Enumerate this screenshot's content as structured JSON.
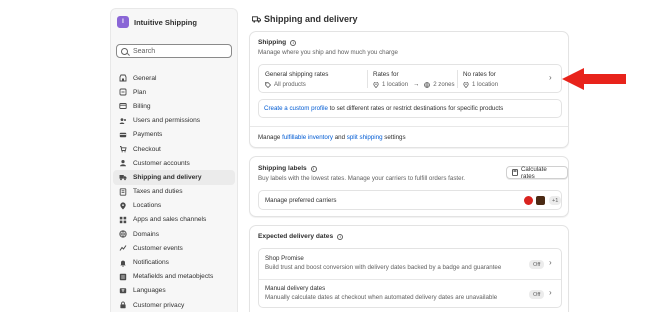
{
  "store": {
    "avatar_letter": "I",
    "name": "Intuitive Shipping"
  },
  "search": {
    "placeholder": "Search"
  },
  "sidebar": {
    "items": [
      {
        "label": "General",
        "icon": "store-icon"
      },
      {
        "label": "Plan",
        "icon": "plan-icon"
      },
      {
        "label": "Billing",
        "icon": "billing-icon"
      },
      {
        "label": "Users and permissions",
        "icon": "users-icon"
      },
      {
        "label": "Payments",
        "icon": "payments-icon"
      },
      {
        "label": "Checkout",
        "icon": "checkout-icon"
      },
      {
        "label": "Customer accounts",
        "icon": "customer-icon"
      },
      {
        "label": "Shipping and delivery",
        "icon": "truck-icon",
        "active": true
      },
      {
        "label": "Taxes and duties",
        "icon": "taxes-icon"
      },
      {
        "label": "Locations",
        "icon": "location-icon"
      },
      {
        "label": "Apps and sales channels",
        "icon": "apps-icon"
      },
      {
        "label": "Domains",
        "icon": "globe-icon"
      },
      {
        "label": "Customer events",
        "icon": "events-icon"
      },
      {
        "label": "Notifications",
        "icon": "bell-icon"
      },
      {
        "label": "Metafields and metaobjects",
        "icon": "metafields-icon"
      },
      {
        "label": "Languages",
        "icon": "languages-icon"
      },
      {
        "label": "Customer privacy",
        "icon": "lock-icon"
      },
      {
        "label": "Policies",
        "icon": "policies-icon"
      }
    ]
  },
  "page": {
    "title": "Shipping and delivery",
    "icon": "truck-icon"
  },
  "shipping": {
    "title": "Shipping",
    "subtitle": "Manage where you ship and how much you charge",
    "general_rates": {
      "label": "General shipping rates",
      "products": "All products",
      "rates_for": "Rates for",
      "location": "1 location",
      "zones": "2 zones",
      "no_rates_for": "No rates for",
      "no_rates_location": "1 location"
    },
    "custom_profile": {
      "link": "Create a custom profile",
      "rest": " to set different rates or restrict destinations for specific products"
    },
    "footer": {
      "prefix": "Manage ",
      "link1": "fulfillable inventory",
      "mid": " and ",
      "link2": "split shipping",
      "suffix": " settings"
    }
  },
  "labels": {
    "title": "Shipping labels",
    "subtitle": "Buy labels with the lowest rates. Manage your carriers to fulfill orders faster.",
    "calculate_button": "Calculate rates",
    "manage_carriers": "Manage preferred carriers",
    "more_count": "+1"
  },
  "delivery": {
    "title": "Expected delivery dates",
    "items": [
      {
        "title": "Shop Promise",
        "desc": "Build trust and boost conversion with delivery dates backed by a badge and guarantee",
        "status": "Off"
      },
      {
        "title": "Manual delivery dates",
        "desc": "Manually calculate dates at checkout when automated delivery dates are unavailable",
        "status": "Off"
      }
    ]
  },
  "colors": {
    "arrow": "#e8231b",
    "link": "#005bd3",
    "active_bg": "#ebebeb",
    "avatar": "#8a66d6"
  }
}
